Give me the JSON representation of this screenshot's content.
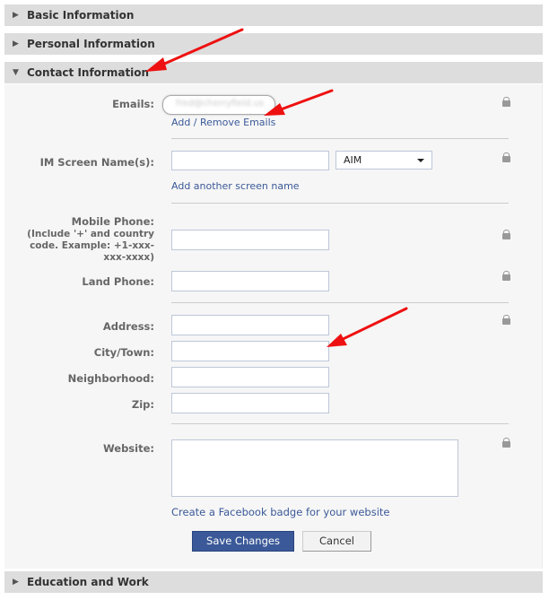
{
  "sections": {
    "basic": {
      "label": "Basic Information",
      "expanded": false
    },
    "personal": {
      "label": "Personal Information",
      "expanded": false
    },
    "contact": {
      "label": "Contact Information",
      "expanded": true
    },
    "education": {
      "label": "Education and Work",
      "expanded": false
    }
  },
  "icons": {
    "collapsed": "▶",
    "expanded": "▼"
  },
  "contact": {
    "emails": {
      "label": "Emails:",
      "value": "fred@cherryfield.us",
      "link": "Add / Remove Emails"
    },
    "im": {
      "label": "IM Screen Name(s):",
      "value": "",
      "service": "AIM",
      "link": "Add another screen name"
    },
    "mobile": {
      "label": "Mobile Phone:",
      "hint_line1": "(Include '+' and country",
      "hint_line2": "code. Example: +1-xxx-",
      "hint_line3": "xxx-xxxx)",
      "value": ""
    },
    "land": {
      "label": "Land Phone:",
      "value": ""
    },
    "address": {
      "label": "Address:",
      "value": ""
    },
    "city": {
      "label": "City/Town:",
      "value": ""
    },
    "neighborhood": {
      "label": "Neighborhood:",
      "value": ""
    },
    "zip": {
      "label": "Zip:",
      "value": ""
    },
    "website": {
      "label": "Website:",
      "value": "",
      "link": "Create a Facebook badge for your website"
    }
  },
  "buttons": {
    "save": "Save Changes",
    "cancel": "Cancel"
  },
  "colors": {
    "brand": "#3b5998",
    "annotation_arrow": "#ee1111",
    "header_bg": "#dddddd"
  }
}
